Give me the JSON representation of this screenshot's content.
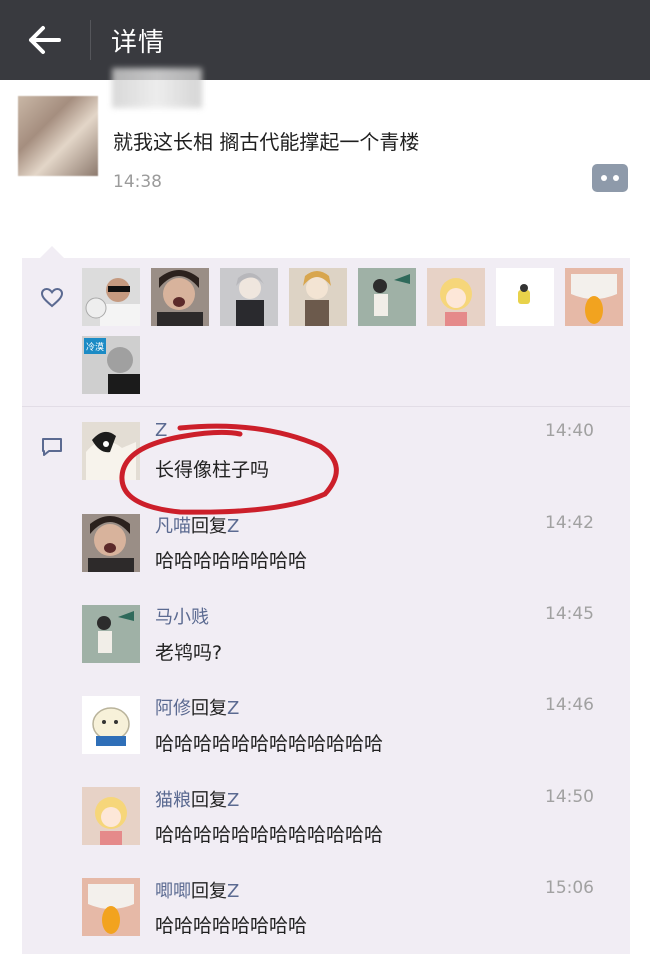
{
  "header": {
    "title": "详情"
  },
  "post": {
    "text": "就我这长相 搁古代能撑起一个青楼",
    "time": "14:38"
  },
  "colors": {
    "topbar": "#393a3f",
    "link": "#5b6a91",
    "panel": "#f1edf4",
    "mark": "#cc1f2a"
  },
  "likes": [
    {
      "icon": "avatar-sunglasses-man"
    },
    {
      "icon": "avatar-screaming-woman"
    },
    {
      "icon": "avatar-anime-boy-gray"
    },
    {
      "icon": "avatar-anime-boy-blonde"
    },
    {
      "icon": "avatar-anime-figure-teal"
    },
    {
      "icon": "avatar-anime-girl-orange"
    },
    {
      "icon": "avatar-yellow-character"
    },
    {
      "icon": "avatar-diaper-peach"
    },
    {
      "icon": "avatar-man-with-sign"
    }
  ],
  "like_sign_text": "冷漠",
  "comments": [
    {
      "name": "Z",
      "reply_word": "",
      "reply_to": "",
      "text": "长得像柱子吗",
      "time": "14:40"
    },
    {
      "name": "凡喵",
      "reply_word": "回复",
      "reply_to": "Z",
      "text": "哈哈哈哈哈哈哈哈",
      "time": "14:42"
    },
    {
      "name": "马小贱",
      "reply_word": "",
      "reply_to": "",
      "text": "老鸨吗?",
      "time": "14:45"
    },
    {
      "name": "阿修",
      "reply_word": "回复",
      "reply_to": "Z",
      "text": "哈哈哈哈哈哈哈哈哈哈哈哈",
      "time": "14:46"
    },
    {
      "name": "猫粮",
      "reply_word": "回复",
      "reply_to": "Z",
      "text": "哈哈哈哈哈哈哈哈哈哈哈哈",
      "time": "14:50"
    },
    {
      "name": "唧唧",
      "reply_word": "回复",
      "reply_to": "Z",
      "text": "哈哈哈哈哈哈哈哈",
      "time": "15:06"
    }
  ]
}
